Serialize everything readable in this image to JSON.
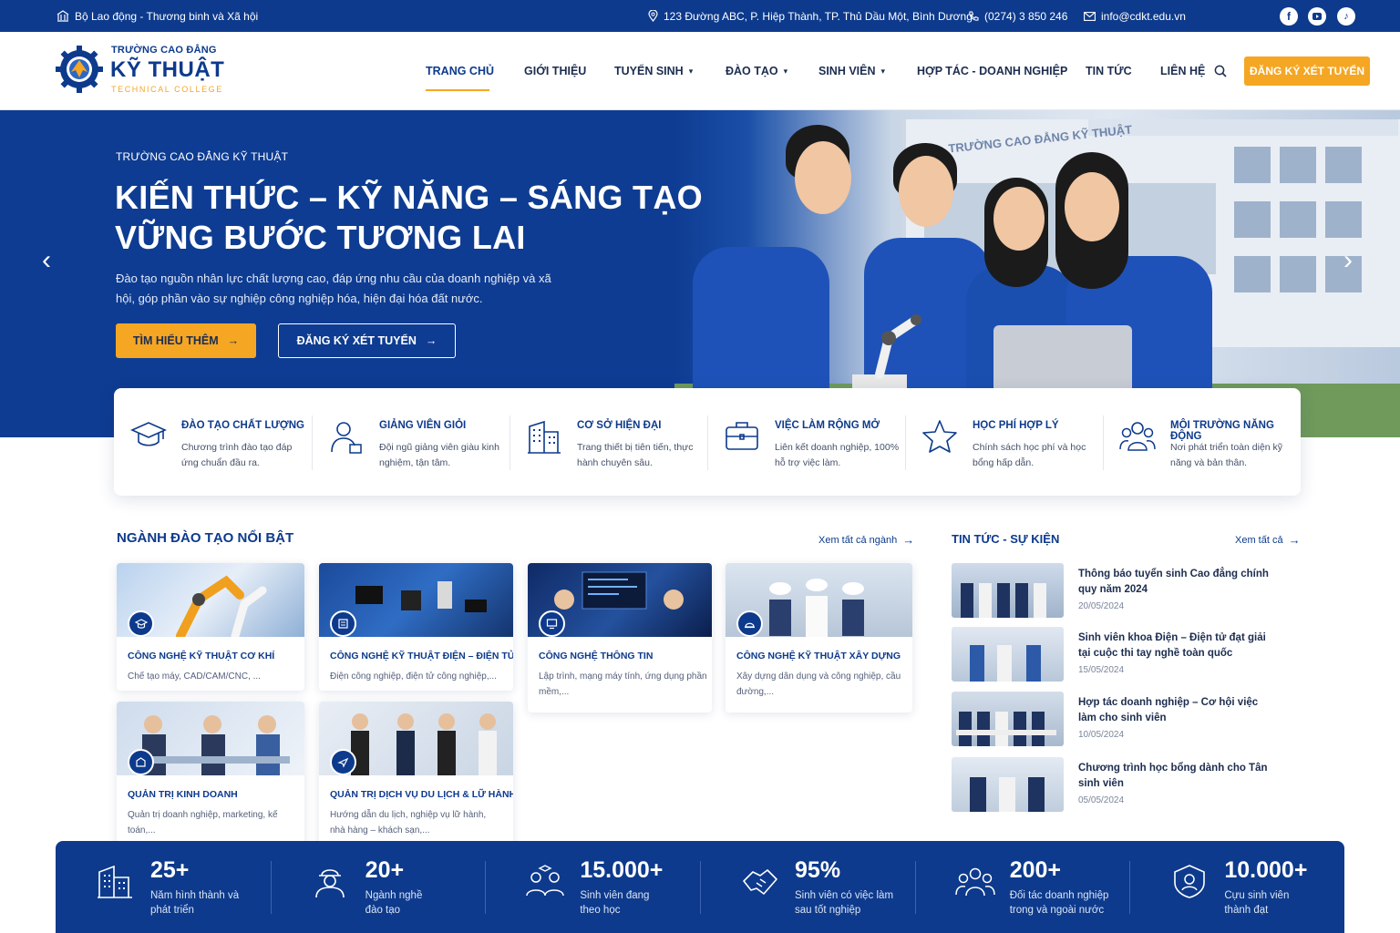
{
  "topbar": {
    "ministry": "Bộ Lao động - Thương binh và Xã hội",
    "address": "123 Đường ABC, P. Hiệp Thành, TP. Thủ Dầu Một, Bình Dương",
    "phone": "(0274) 3 850 246",
    "email": "info@cdkt.edu.vn",
    "social": [
      "facebook-icon",
      "youtube-icon",
      "tiktok-icon"
    ]
  },
  "logo": {
    "line1": "TRƯỜNG CAO ĐẲNG",
    "line2": "KỸ THUẬT",
    "line3": "TECHNICAL COLLEGE"
  },
  "nav": {
    "items": [
      {
        "label": "TRANG CHỦ",
        "active": true
      },
      {
        "label": "GIỚI THIỆU"
      },
      {
        "label": "TUYỂN SINH",
        "dropdown": true
      },
      {
        "label": "ĐÀO TẠO",
        "dropdown": true
      },
      {
        "label": "SINH VIÊN",
        "dropdown": true
      },
      {
        "label": "HỢP TÁC - DOANH NGHIỆP"
      },
      {
        "label": "TIN TỨC"
      },
      {
        "label": "LIÊN HỆ"
      }
    ],
    "cta": "ĐĂNG KÝ XÉT TUYỂN"
  },
  "hero": {
    "subtitle": "TRƯỜNG CAO ĐẲNG KỸ THUẬT",
    "title_line1": "KIẾN THỨC – KỸ NĂNG – SÁNG TẠO",
    "title_line2": "VỮNG BƯỚC TƯƠNG LAI",
    "description": "Đào tạo nguồn nhân lực chất lượng cao, đáp ứng nhu cầu của doanh nghiệp và xã hội, góp phần vào sự nghiệp công nghiệp hóa, hiện đại hóa đất nước.",
    "btn_primary": "TÌM HIỂU THÊM",
    "btn_secondary": "ĐĂNG KÝ XÉT TUYỂN",
    "building_sign": "TRƯỜNG CAO ĐẲNG KỸ THUẬT"
  },
  "features": [
    {
      "icon": "graduation-cap-icon",
      "title": "ĐÀO TẠO CHẤT LƯỢNG",
      "desc": "Chương trình đào tạo đáp ứng chuẩn đầu ra."
    },
    {
      "icon": "teacher-icon",
      "title": "GIẢNG VIÊN GIỎI",
      "desc": "Đội ngũ giảng viên giàu kinh nghiệm, tận tâm."
    },
    {
      "icon": "building-icon",
      "title": "CƠ SỞ HIỆN ĐẠI",
      "desc": "Trang thiết bị tiên tiến, thực hành chuyên sâu."
    },
    {
      "icon": "briefcase-icon",
      "title": "VIỆC LÀM RỘNG MỞ",
      "desc": "Liên kết doanh nghiệp, 100% hỗ trợ việc làm."
    },
    {
      "icon": "star-icon",
      "title": "HỌC PHÍ HỢP LÝ",
      "desc": "Chính sách học phí và học bổng hấp dẫn."
    },
    {
      "icon": "people-icon",
      "title": "MÔI TRƯỜNG NĂNG ĐỘNG",
      "desc": "Nơi phát triển toàn diện kỹ năng và bản thân."
    }
  ],
  "majors": {
    "title": "NGÀNH ĐÀO TẠO NỔI BẬT",
    "see_all": "Xem tất cả ngành",
    "items": [
      {
        "title": "CÔNG NGHỆ KỸ THUẬT CƠ KHÍ",
        "desc": "Chế tạo máy, CAD/CAM/CNC, ..."
      },
      {
        "title": "CÔNG NGHỆ KỸ THUẬT ĐIỆN – ĐIỆN TỬ",
        "desc": "Điện công nghiệp, điện tử công nghiệp,..."
      },
      {
        "title": "CÔNG NGHỆ THÔNG TIN",
        "desc": "Lập trình, mạng máy tính, ứng dụng phần mềm,..."
      },
      {
        "title": "CÔNG NGHỆ KỸ THUẬT XÂY DỰNG",
        "desc": "Xây dựng dân dụng và công nghiệp, cầu đường,..."
      },
      {
        "title": "QUẢN TRỊ KINH DOANH",
        "desc": "Quản trị doanh nghiệp, marketing, kế toán,..."
      },
      {
        "title": "QUẢN TRỊ DỊCH VỤ DU LỊCH & LỮ HÀNH",
        "desc": "Hướng dẫn du lịch, nghiệp vụ lữ hành, nhà hàng – khách sạn,..."
      }
    ]
  },
  "news": {
    "title": "TIN TỨC - SỰ KIỆN",
    "see_all": "Xem tất cả",
    "items": [
      {
        "title": "Thông báo tuyển sinh Cao đẳng chính quy năm 2024",
        "date": "20/05/2024"
      },
      {
        "title": "Sinh viên khoa Điện – Điện tử đạt giải tại cuộc thi tay nghề toàn quốc",
        "date": "15/05/2024"
      },
      {
        "title": "Hợp tác doanh nghiệp – Cơ hội việc làm cho sinh viên",
        "date": "10/05/2024"
      },
      {
        "title": "Chương trình học bổng dành cho Tân sinh viên",
        "date": "05/05/2024"
      }
    ]
  },
  "stats": [
    {
      "icon": "building-icon",
      "value": "25+",
      "label": "Năm hình thành và phát triển"
    },
    {
      "icon": "engineer-icon",
      "value": "20+",
      "label": "Ngành nghề đào tạo"
    },
    {
      "icon": "students-icon",
      "value": "15.000+",
      "label": "Sinh viên đang theo học"
    },
    {
      "icon": "handshake-icon",
      "value": "95%",
      "label": "Sinh viên có việc làm sau tốt nghiệp"
    },
    {
      "icon": "partners-icon",
      "value": "200+",
      "label": "Đối tác doanh nghiệp trong và ngoài nước"
    },
    {
      "icon": "alumni-icon",
      "value": "10.000+",
      "label": "Cựu sinh viên thành đạt"
    }
  ],
  "colors": {
    "primary": "#0d3a8c",
    "accent": "#f5a623"
  }
}
